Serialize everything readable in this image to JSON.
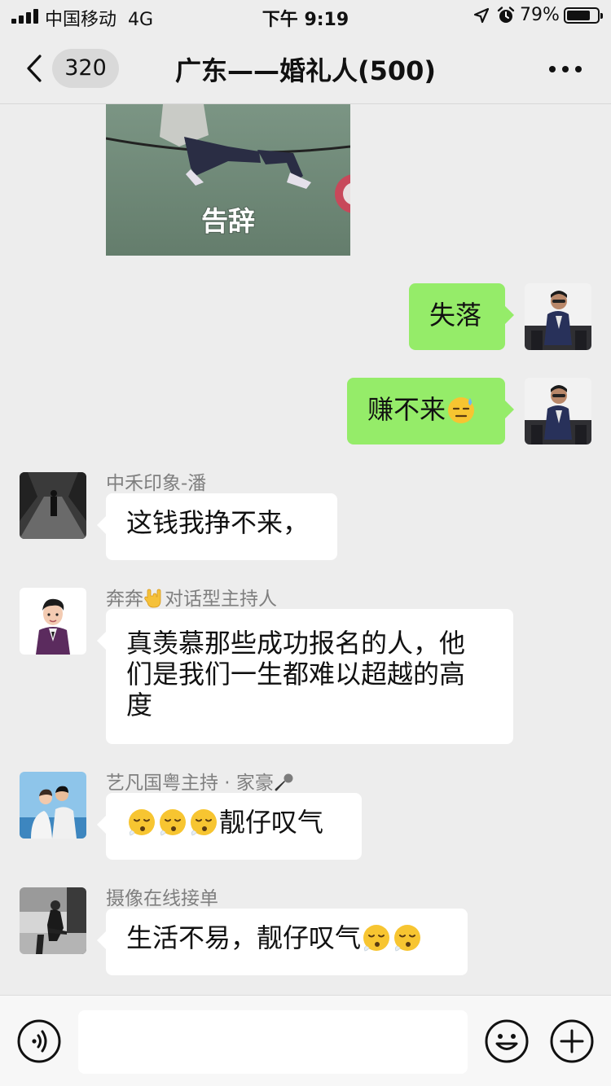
{
  "status_bar": {
    "carrier": "中国移动",
    "network": "4G",
    "time": "下午 9:19",
    "battery": "79%",
    "battery_level": 0.79
  },
  "header": {
    "unread_count": "320",
    "title": "广东——婚礼人(500)"
  },
  "messages": [
    {
      "type": "image",
      "direction": "in",
      "caption": "告辞"
    },
    {
      "type": "text",
      "direction": "out",
      "text": "失落"
    },
    {
      "type": "text",
      "direction": "out",
      "text": "赚不来",
      "emoji": "sweat-smile-emoji"
    },
    {
      "type": "text",
      "direction": "in",
      "sender": "中禾印象-潘",
      "text": "这钱我挣不来，"
    },
    {
      "type": "text",
      "direction": "in",
      "sender_prefix": "奔奔",
      "sender_emoji": "rock-hand-emoji",
      "sender_suffix": "对话型主持人",
      "text_line1": "真羡慕那些成功报名的人，他",
      "text_line2": "们是我们一生都难以超越的高",
      "text_line3": "度"
    },
    {
      "type": "text",
      "direction": "in",
      "sender_prefix": "艺凡国粤主持 · 家豪",
      "sender_emoji": "microphone-emoji",
      "emojis": [
        "sighing-face-emoji",
        "sighing-face-emoji",
        "sighing-face-emoji"
      ],
      "text": "靓仔叹气"
    },
    {
      "type": "text",
      "direction": "in",
      "sender": "摄像在线接单",
      "text": "生活不易，靓仔叹气",
      "emojis": [
        "sighing-face-emoji",
        "sighing-face-emoji"
      ]
    }
  ],
  "colors": {
    "background": "#ededed",
    "out_bubble": "#95ec69",
    "in_bubble": "#ffffff",
    "sender_name": "#7f7f7f"
  },
  "input": {
    "placeholder": "",
    "value": ""
  }
}
